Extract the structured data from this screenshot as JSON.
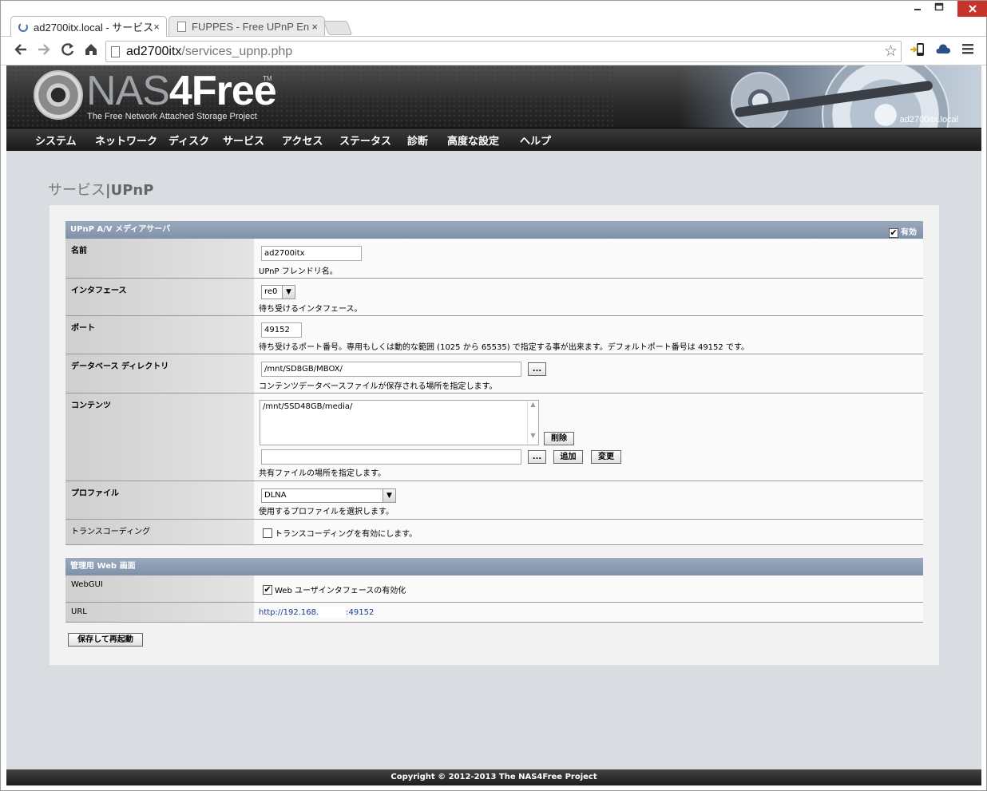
{
  "browser": {
    "tabs": [
      {
        "title": "ad2700itx.local - サービス",
        "active": true
      },
      {
        "title": "FUPPES - Free UPnP En",
        "active": false
      }
    ],
    "close_glyph": "×",
    "url_host": "ad2700itx",
    "url_path": "/services_upnp.php",
    "window_controls": [
      "minimize-icon",
      "maximize-icon",
      "close-icon"
    ]
  },
  "header": {
    "logo_nas": "NAS",
    "logo_4free": "4Free",
    "logo_tm": "TM",
    "tagline": "The Free Network Attached Storage Project",
    "hostname": "ad2700itx.local"
  },
  "menu": [
    "システム",
    "ネットワーク",
    "ディスク",
    "サービス",
    "アクセス",
    "ステータス",
    "診断",
    "高度な設定",
    "ヘルプ"
  ],
  "page_title": {
    "section": "サービス",
    "sep": "|",
    "name": "UPnP"
  },
  "upnp": {
    "heading": "UPnP A/V メディアサーバ",
    "enable_label": "有効",
    "enabled": true,
    "name_label": "名前",
    "name_value": "ad2700itx",
    "name_hint": "UPnP フレンドリ名。",
    "interface_label": "インタフェース",
    "interface_value": "re0",
    "interface_hint": "待ち受けるインタフェース。",
    "port_label": "ポート",
    "port_value": "49152",
    "port_hint": "待ち受けるポート番号。専用もしくは動的な範囲 (1025 から 65535) で指定する事が出来ます。デフォルトポート番号は 49152 です。",
    "db_label": "データベース ディレクトリ",
    "db_value": "/mnt/SD8GB/MBOX/",
    "db_browse": "...",
    "db_hint": "コンテンツデータベースファイルが保存される場所を指定します。",
    "content_label": "コンテンツ",
    "content_items": [
      "/mnt/SSD48GB/media/"
    ],
    "content_delete": "削除",
    "content_browse": "...",
    "content_add": "追加",
    "content_change": "変更",
    "content_input": "",
    "content_hint": "共有ファイルの場所を指定します。",
    "profile_label": "プロファイル",
    "profile_value": "DLNA",
    "profile_hint": "使用するプロファイルを選択します。",
    "transcode_label": "トランスコーディング",
    "transcode_checked": false,
    "transcode_text": "トランスコーディングを有効にします。"
  },
  "admin": {
    "heading": "管理用 Web 画面",
    "webgui_label": "WebGUI",
    "webgui_checked": true,
    "webgui_text": "Web ユーザインタフェースの有効化",
    "url_label": "URL",
    "url_prefix": "http://192.168.",
    "url_suffix": ":49152"
  },
  "save_button": "保存して再起動",
  "footer": "Copyright © 2012-2013 The NAS4Free Project"
}
